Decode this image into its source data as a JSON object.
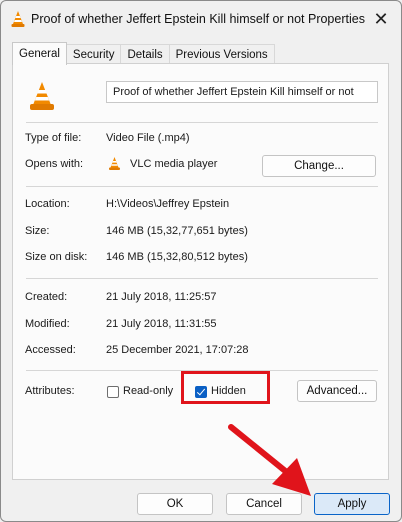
{
  "window": {
    "title": "Proof of whether Jeffert Epstein Kill himself or not Properties",
    "close_glyph": "✕"
  },
  "tabs": [
    "General",
    "Security",
    "Details",
    "Previous Versions"
  ],
  "active_tab": "General",
  "general": {
    "file_name": "Proof of whether Jeffert Epstein Kill himself or not",
    "type_label": "Type of file:",
    "type_value": "Video File (.mp4)",
    "opens_label": "Opens with:",
    "opens_value": "VLC media player",
    "change_button": "Change...",
    "location_label": "Location:",
    "location_value": "H:\\Videos\\Jeffrey Epstein",
    "size_label": "Size:",
    "size_value": "146 MB (15,32,77,651 bytes)",
    "size_disk_label": "Size on disk:",
    "size_disk_value": "146 MB (15,32,80,512 bytes)",
    "created_label": "Created:",
    "created_value": "21 July 2018, 11:25:57",
    "modified_label": "Modified:",
    "modified_value": "21 July 2018, 11:31:55",
    "accessed_label": "Accessed:",
    "accessed_value": "25 December 2021, 17:07:28",
    "attributes_label": "Attributes:",
    "readonly_label": "Read-only",
    "readonly_checked": false,
    "hidden_label": "Hidden",
    "hidden_checked": true,
    "advanced_button": "Advanced..."
  },
  "footer": {
    "ok": "OK",
    "cancel": "Cancel",
    "apply": "Apply"
  },
  "colors": {
    "highlight": "#e0141b",
    "accent": "#0a5fc4",
    "vlc_orange": "#f28a00"
  },
  "icons": {
    "title": "vlc-cone-icon",
    "file": "vlc-cone-icon",
    "opens_with": "vlc-cone-icon",
    "close": "close-icon",
    "annotation": "red-arrow-icon"
  }
}
